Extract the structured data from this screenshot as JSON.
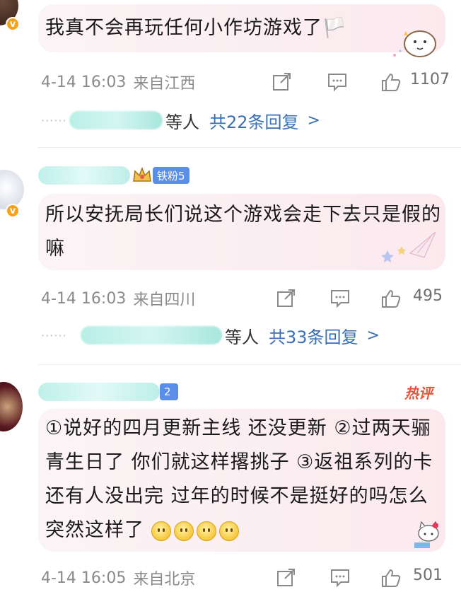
{
  "comments": [
    {
      "text": "我真不会再玩任何小作坊游戏了🏳️",
      "time": "4-14 16:03",
      "location": "来自江西",
      "likes": "1107",
      "reply_suffix": "等人",
      "reply_total": "共22条回复"
    },
    {
      "fan_badge": "铁粉5",
      "text": "所以安抚局长们说这个游戏会走下去只是假的嘛",
      "time": "4-14 16:03",
      "location": "来自四川",
      "likes": "495",
      "reply_suffix": "等人",
      "reply_total": "共33条回复"
    },
    {
      "fan_badge": "2",
      "hot_label": "热评",
      "text": "①说好的四月更新主线 还没更新 ②过两天骊青生日了 你们就这样撂挑子 ③返祖系列的卡还有人没出完 过年的时候不是挺好的吗怎么突然这样了",
      "time": "4-14 16:05",
      "location": "来自北京",
      "likes": "501"
    }
  ],
  "icons": {
    "share": "share-icon",
    "comment": "comment-icon",
    "like": "thumbs-up-icon",
    "chevron": "chevron-right-icon",
    "verified": "verified-badge-icon",
    "crown": "crown-icon"
  },
  "colors": {
    "link_blue": "#3a6fb7",
    "hot_red": "#e8543c",
    "verified_orange": "#f7a11a",
    "fan_blue": "#5b8ee6"
  }
}
